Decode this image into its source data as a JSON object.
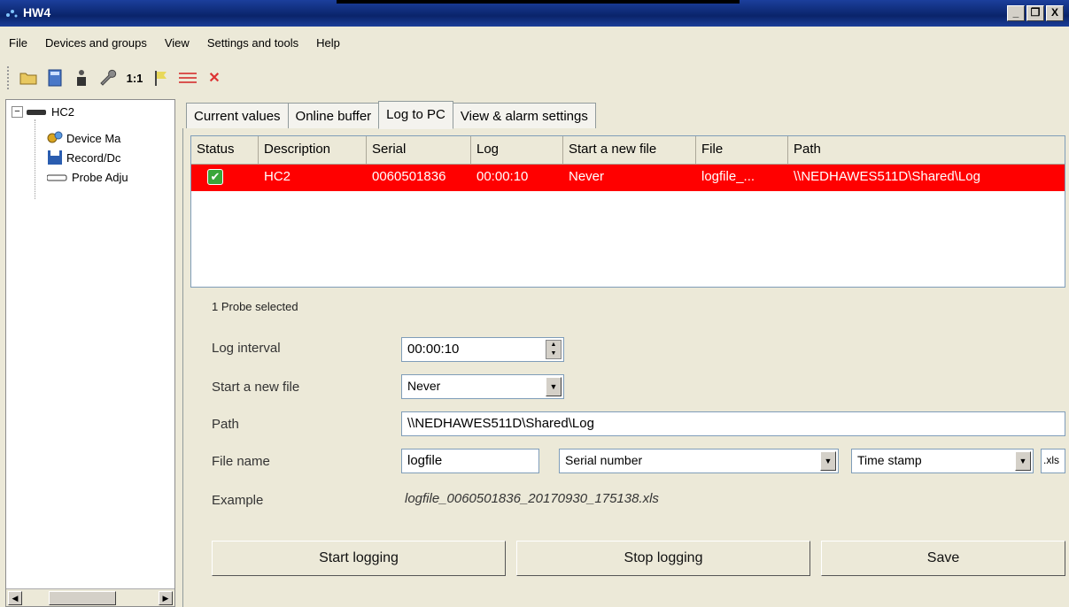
{
  "window": {
    "title": "HW4",
    "buttons": [
      "_",
      "❐",
      "X"
    ]
  },
  "menu": [
    "File",
    "Devices and groups",
    "View",
    "Settings and tools",
    "Help"
  ],
  "toolbar": {
    "icons": [
      "open-folder-icon",
      "calculator-icon",
      "person-icon",
      "wrench-icon",
      "ratio-label",
      "flag-icon",
      "lines-icon",
      "delete-icon"
    ],
    "ratio_label": "1:1",
    "delete_glyph": "✕"
  },
  "tree": {
    "root": "HC2",
    "toggle": "−",
    "children": [
      "Device Ma",
      "Record/Dc",
      "Probe Adju"
    ]
  },
  "tabs": [
    "Current values",
    "Online buffer",
    "Log to PC",
    "View & alarm settings"
  ],
  "active_tab": "Log to PC",
  "grid": {
    "columns": [
      "Status",
      "Description",
      "Serial",
      "Log",
      "Start a new file",
      "File",
      "Path"
    ],
    "rows": [
      {
        "status": "✔",
        "description": "HC2",
        "serial": "0060501836",
        "log": "00:00:10",
        "start_new_file": "Never",
        "file": "logfile_...",
        "path": "\\\\NEDHAWES511D\\Shared\\Log"
      }
    ]
  },
  "selection_text": "1 Probe selected",
  "form": {
    "log_interval_label": "Log interval",
    "log_interval_value": "00:00:10",
    "start_new_file_label": "Start a new file",
    "start_new_file_value": "Never",
    "path_label": "Path",
    "path_value": "\\\\NEDHAWES511D\\Shared\\Log",
    "file_name_label": "File name",
    "file_name_value": "logfile",
    "serial_number_option": "Serial number",
    "time_stamp_option": "Time stamp",
    "extension": ".xls",
    "example_label": "Example",
    "example_value": "logfile_0060501836_20170930_175138.xls"
  },
  "buttons": {
    "start": "Start logging",
    "stop": "Stop logging",
    "save": "Save"
  },
  "colors": {
    "selected_row": "#ff0000",
    "titlebar": "#0a246a"
  }
}
